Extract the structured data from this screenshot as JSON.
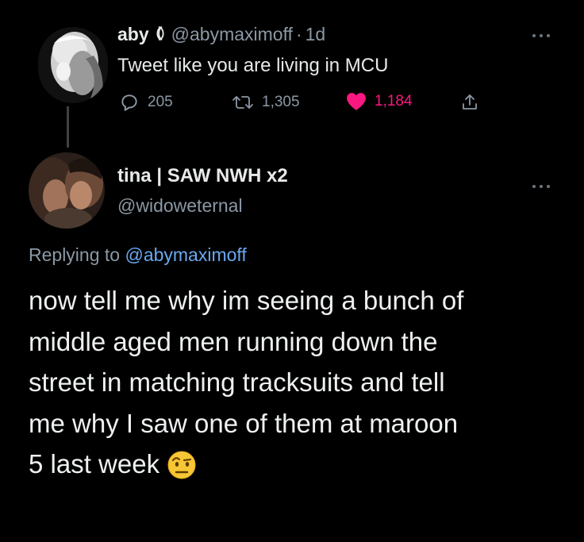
{
  "tweet1": {
    "display_name": "aby",
    "name_icon": "moon-icon",
    "handle": "@abymaximoff",
    "separator": "·",
    "time": "1d",
    "text": "Tweet like you are living in MCU",
    "more_icon": "ellipsis-icon",
    "actions": {
      "replies": "205",
      "retweets": "1,305",
      "likes": "1,184",
      "like_color": "#f91880"
    }
  },
  "tweet2": {
    "display_name": "tina | SAW NWH x2",
    "handle": "@widoweternal",
    "more_icon": "ellipsis-icon",
    "replying_prefix": "Replying to",
    "replying_to": "@abymaximoff",
    "text_lines": [
      "now tell me why im seeing a bunch of",
      "middle aged men running down the",
      "street in matching tracksuits and tell",
      "me why I saw one of them at maroon",
      "5 last week"
    ],
    "emoji": "face-with-raised-eyebrow"
  },
  "colors": {
    "background": "#000000",
    "text": "#e7e9ea",
    "muted": "#8b98a5",
    "link": "#6aa8f0"
  }
}
